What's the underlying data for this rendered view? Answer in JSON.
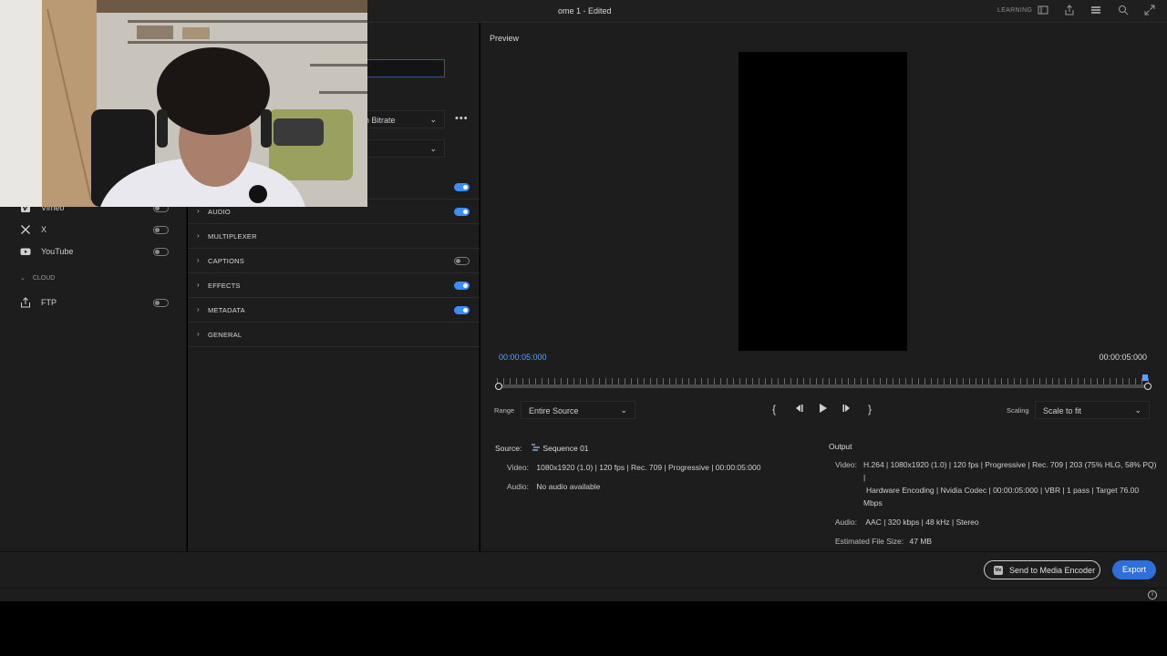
{
  "window": {
    "title": "ome 1 - Edited",
    "learning": "LEARNING"
  },
  "topbar_icons": [
    "panel-icon",
    "share-icon",
    "menu-icon",
    "search-icon",
    "expand-icon"
  ],
  "left_panel": {
    "destinations": [
      {
        "label": "Vimeo",
        "icon": "vimeo-icon",
        "enabled": false
      },
      {
        "label": "X",
        "icon": "x-icon",
        "enabled": false
      },
      {
        "label": "YouTube",
        "icon": "youtube-icon",
        "enabled": false
      }
    ],
    "cloud_header": "CLOUD",
    "cloud": [
      {
        "label": "FTP",
        "icon": "upload-icon",
        "enabled": false
      }
    ]
  },
  "middle_panel": {
    "preset_dropdown": "h Bitrate",
    "sections": [
      {
        "label": "AUDIO",
        "enabled": true
      },
      {
        "label": "MULTIPLEXER",
        "enabled": null
      },
      {
        "label": "CAPTIONS",
        "enabled": false
      },
      {
        "label": "EFFECTS",
        "enabled": true
      },
      {
        "label": "METADATA",
        "enabled": true
      },
      {
        "label": "GENERAL",
        "enabled": null
      }
    ]
  },
  "preview": {
    "label": "Preview",
    "timecode_current": "00:00:05:000",
    "timecode_end": "00:00:05:000",
    "range_label": "Range",
    "range_value": "Entire Source",
    "scaling_label": "Scaling",
    "scaling_value": "Scale to fit"
  },
  "source": {
    "label": "Source:",
    "name": "Sequence 01",
    "video_label": "Video:",
    "video_value": "1080x1920 (1.0) | 120 fps | Rec. 709 | Progressive | 00:00:05:000",
    "audio_label": "Audio:",
    "audio_value": "No audio available"
  },
  "output": {
    "label": "Output",
    "video_label": "Video:",
    "video_line1": "H.264 | 1080x1920 (1.0) | 120 fps | Progressive | Rec. 709 | 203 (75% HLG, 58% PQ) |",
    "video_line2": "Hardware Encoding | Nvidia Codec | 00:00:05:000 | VBR | 1 pass | Target 76.00",
    "video_line3": "Mbps",
    "audio_label": "Audio:",
    "audio_value": "AAC | 320 kbps | 48 kHz | Stereo",
    "size_label": "Estimated File Size:",
    "size_value": "47 MB"
  },
  "footer": {
    "send_label": "Send to Media Encoder",
    "send_badge": "Me",
    "export_label": "Export"
  },
  "colors": {
    "accent": "#3d8bfd",
    "panel": "#1d1d1d",
    "timecode": "#5aa2ff"
  }
}
